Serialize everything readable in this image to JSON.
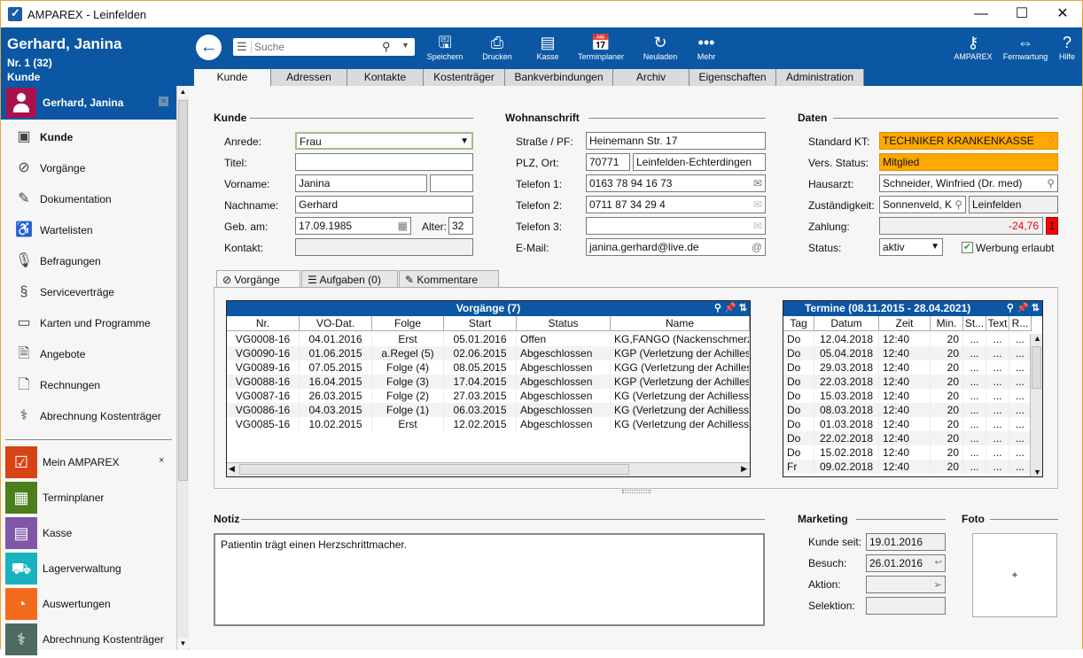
{
  "window": {
    "title": "AMPAREX - Leinfelden",
    "minimize": "—",
    "maximize": "☐",
    "close": "✕"
  },
  "patient": {
    "name": "Gerhard, Janina",
    "number": "Nr. 1 (32)",
    "type": "Kunde"
  },
  "search": {
    "placeholder": "Suche"
  },
  "toolbar": [
    {
      "label": "Speichern",
      "icon": "save-icon"
    },
    {
      "label": "Drucken",
      "icon": "print-icon"
    },
    {
      "label": "Kasse",
      "icon": "cash-register-icon"
    },
    {
      "label": "Terminplaner",
      "icon": "calendar-icon"
    },
    {
      "label": "Neuladen",
      "icon": "reload-icon"
    },
    {
      "label": "Mehr",
      "icon": "more-icon"
    }
  ],
  "toolbar_right": [
    {
      "label": "AMPAREX",
      "icon": "key-icon"
    },
    {
      "label": "Fernwartung",
      "icon": "remote-icon"
    },
    {
      "label": "Hilfe",
      "icon": "help-icon"
    }
  ],
  "tabs": [
    "Kunde",
    "Adressen",
    "Kontakte",
    "Kostenträger",
    "Bankverbindungen",
    "Archiv",
    "Eigenschaften",
    "Administration"
  ],
  "active_tab": "Kunde",
  "sidebar": {
    "header": "Gerhard, Janina",
    "items": [
      {
        "label": "Kunde",
        "icon": "customer-card-icon"
      },
      {
        "label": "Vorgänge",
        "icon": "paperclip-icon"
      },
      {
        "label": "Dokumentation",
        "icon": "pencil-icon"
      },
      {
        "label": "Wartelisten",
        "icon": "waiting-chair-icon"
      },
      {
        "label": "Befragungen",
        "icon": "microphone-icon"
      },
      {
        "label": "Serviceverträge",
        "icon": "paragraph-icon"
      },
      {
        "label": "Karten und Programme",
        "icon": "cards-icon"
      },
      {
        "label": "Angebote",
        "icon": "offer-icon"
      },
      {
        "label": "Rechnungen",
        "icon": "invoice-icon"
      },
      {
        "label": "Abrechnung Kostenträger",
        "icon": "caduceus-icon"
      }
    ],
    "modules": [
      {
        "label": "Mein AMPAREX",
        "color": "#d84315",
        "icon": "clipboard-icon",
        "closable": "×"
      },
      {
        "label": "Terminplaner",
        "color": "#4a7f1c",
        "icon": "calendar-icon"
      },
      {
        "label": "Kasse",
        "color": "#7e57a8",
        "icon": "cash-register-icon"
      },
      {
        "label": "Lagerverwaltung",
        "color": "#19b3c0",
        "icon": "hand-truck-icon"
      },
      {
        "label": "Auswertungen",
        "color": "#f26b1d",
        "icon": "pie-chart-icon"
      },
      {
        "label": "Abrechnung Kostenträger",
        "color": "#4d6b60",
        "icon": "caduceus-icon"
      }
    ]
  },
  "kunde": {
    "section": "Kunde",
    "anrede_label": "Anrede:",
    "anrede": "Frau",
    "titel_label": "Titel:",
    "titel": "",
    "vorname_label": "Vorname:",
    "vorname": "Janina",
    "vorname2": "",
    "nachname_label": "Nachname:",
    "nachname": "Gerhard",
    "geb_label": "Geb. am:",
    "geb": "17.09.1985",
    "alter_label": "Alter:",
    "alter": "32",
    "kontakt_label": "Kontakt:",
    "kontakt": ""
  },
  "wohnanschrift": {
    "section": "Wohnanschrift",
    "strasse_label": "Straße / PF:",
    "strasse": "Heinemann Str. 17",
    "plz_label": "PLZ, Ort:",
    "plz": "70771",
    "ort": "Leinfelden-Echterdingen",
    "tel1_label": "Telefon 1:",
    "tel1": "0163 78 94 16 73",
    "tel2_label": "Telefon 2:",
    "tel2": "0711 87 34 29 4",
    "tel3_label": "Telefon 3:",
    "tel3": "",
    "email_label": "E-Mail:",
    "email": "janina.gerhard@live.de"
  },
  "daten": {
    "section": "Daten",
    "kt_label": "Standard KT:",
    "kt": "TECHNIKER KRANKENKASSE",
    "vers_label": "Vers. Status:",
    "vers": "Mitglied",
    "hausarzt_label": "Hausarzt:",
    "hausarzt": "Schneider, Winfried (Dr. med)",
    "zust_label": "Zuständigkeit:",
    "zust": "Sonnenveld, K",
    "zust_ort": "Leinfelden",
    "zahlung_label": "Zahlung:",
    "zahlung": "-24,76",
    "zahlung_badge": "1",
    "status_label": "Status:",
    "status": "aktiv",
    "werbung_label": "Werbung erlaubt",
    "werbung_checked": true
  },
  "subtabs": [
    "Vorgänge",
    "Aufgaben (0)",
    "Kommentare"
  ],
  "vorgaenge": {
    "title": "Vorgänge (7)",
    "columns": [
      "Nr.",
      "VO-Dat.",
      "Folge",
      "Start",
      "Status",
      "Name"
    ],
    "rows": [
      [
        "VG0008-16",
        "04.01.2016",
        "Erst",
        "05.01.2016",
        "Offen",
        "KG,FANGO (Nackenschmerzen"
      ],
      [
        "VG0090-16",
        "01.06.2015",
        "a.Regel (5)",
        "02.06.2015",
        "Abgeschlossen",
        "KGP (Verletzung der Achilles"
      ],
      [
        "VG0089-16",
        "07.05.2015",
        "Folge (4)",
        "08.05.2015",
        "Abgeschlossen",
        "KGG (Verletzung der Achilles"
      ],
      [
        "VG0088-16",
        "16.04.2015",
        "Folge (3)",
        "17.04.2015",
        "Abgeschlossen",
        "KGP (Verletzung der Achilles"
      ],
      [
        "VG0087-16",
        "26.03.2015",
        "Folge (2)",
        "27.03.2015",
        "Abgeschlossen",
        "KG (Verletzung der Achilless"
      ],
      [
        "VG0086-16",
        "04.03.2015",
        "Folge (1)",
        "06.03.2015",
        "Abgeschlossen",
        "KG (Verletzung der Achilless"
      ],
      [
        "VG0085-16",
        "10.02.2015",
        "Erst",
        "12.02.2015",
        "Abgeschlossen",
        "KG (Verletzung der Achilless"
      ]
    ]
  },
  "termine": {
    "title": "Termine (08.11.2015 - 28.04.2021)",
    "columns": [
      "Tag",
      "Datum",
      "Zeit",
      "Min.",
      "St...",
      "Text",
      "R..."
    ],
    "rows": [
      [
        "Do",
        "12.04.2018",
        "12:40",
        "20",
        "...",
        "...",
        "..."
      ],
      [
        "Do",
        "05.04.2018",
        "12:40",
        "20",
        "...",
        "...",
        "..."
      ],
      [
        "Do",
        "29.03.2018",
        "12:40",
        "20",
        "...",
        "...",
        "..."
      ],
      [
        "Do",
        "22.03.2018",
        "12:40",
        "20",
        "...",
        "...",
        "..."
      ],
      [
        "Do",
        "15.03.2018",
        "12:40",
        "20",
        "...",
        "...",
        "..."
      ],
      [
        "Do",
        "08.03.2018",
        "12:40",
        "20",
        "...",
        "...",
        "..."
      ],
      [
        "Do",
        "01.03.2018",
        "12:40",
        "20",
        "...",
        "...",
        "..."
      ],
      [
        "Do",
        "22.02.2018",
        "12:40",
        "20",
        "...",
        "...",
        "..."
      ],
      [
        "Do",
        "15.02.2018",
        "12:40",
        "20",
        "...",
        "...",
        "..."
      ],
      [
        "Fr",
        "09.02.2018",
        "12:40",
        "20",
        "...",
        "...",
        "..."
      ]
    ]
  },
  "notiz": {
    "section": "Notiz",
    "text": "Patientin trägt einen Herzschrittmacher."
  },
  "marketing": {
    "section": "Marketing",
    "kunde_seit_label": "Kunde seit:",
    "kunde_seit": "19.01.2016",
    "besuch_label": "Besuch:",
    "besuch": "26.01.2016",
    "aktion_label": "Aktion:",
    "aktion": "",
    "selektion_label": "Selektion:",
    "selektion": ""
  },
  "foto": {
    "section": "Foto",
    "add": "+"
  }
}
